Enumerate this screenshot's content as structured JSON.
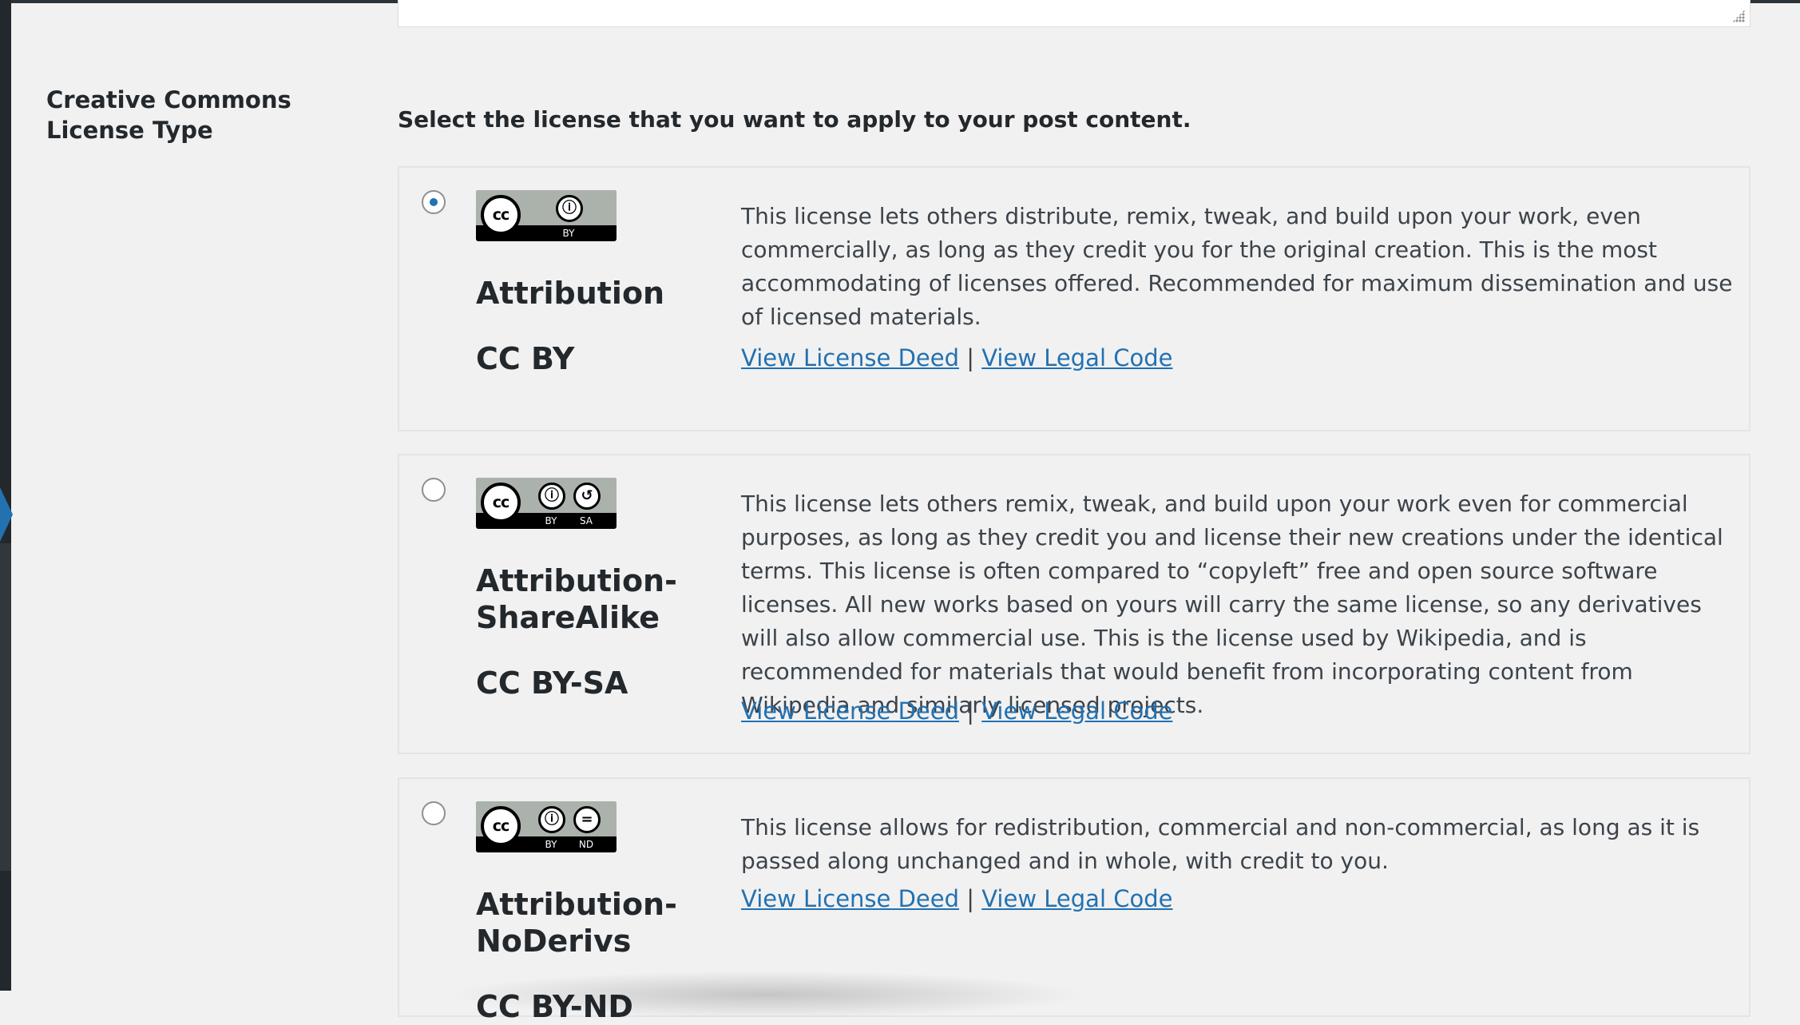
{
  "field_label": "Creative Commons License Type",
  "intro": "Select the license that you want to apply to your post content.",
  "deed_link_label": "View License Deed",
  "legal_link_label": "View Legal Code",
  "separator": "|",
  "colors": {
    "accent": "#2271b1",
    "text": "#23282d",
    "background": "#f1f1f1"
  },
  "licenses": [
    {
      "name": "Attribution",
      "code": "CC BY",
      "selected": true,
      "badge": {
        "cc": "cc",
        "icons": [
          "by-icon"
        ],
        "labels": [
          "BY"
        ]
      },
      "description": "This license lets others distribute, remix, tweak, and build upon your work, even commercially, as long as they credit you for the original creation. This is the most accommodating of licenses offered. Recommended for maximum dissemination and use of licensed materials."
    },
    {
      "name": "Attribution-ShareAlike",
      "code": "CC BY-SA",
      "selected": false,
      "badge": {
        "cc": "cc",
        "icons": [
          "by-icon",
          "sa-icon"
        ],
        "labels": [
          "BY",
          "SA"
        ]
      },
      "description": "This license lets others remix, tweak, and build upon your work even for commercial purposes, as long as they credit you and license their new creations under the identical terms. This license is often compared to “copyleft” free and open source software licenses. All new works based on yours will carry the same license, so any derivatives will also allow commercial use. This is the license used by Wikipedia, and is recommended for materials that would benefit from incorporating content from Wikipedia and similarly licensed projects."
    },
    {
      "name": "Attribution-NoDerivs",
      "code": "CC BY-ND",
      "selected": false,
      "badge": {
        "cc": "cc",
        "icons": [
          "by-icon",
          "nd-icon"
        ],
        "labels": [
          "BY",
          "ND"
        ]
      },
      "description": "This license allows for redistribution, commercial and non-commercial, as long as it is passed along unchanged and in whole, with credit to you."
    }
  ]
}
